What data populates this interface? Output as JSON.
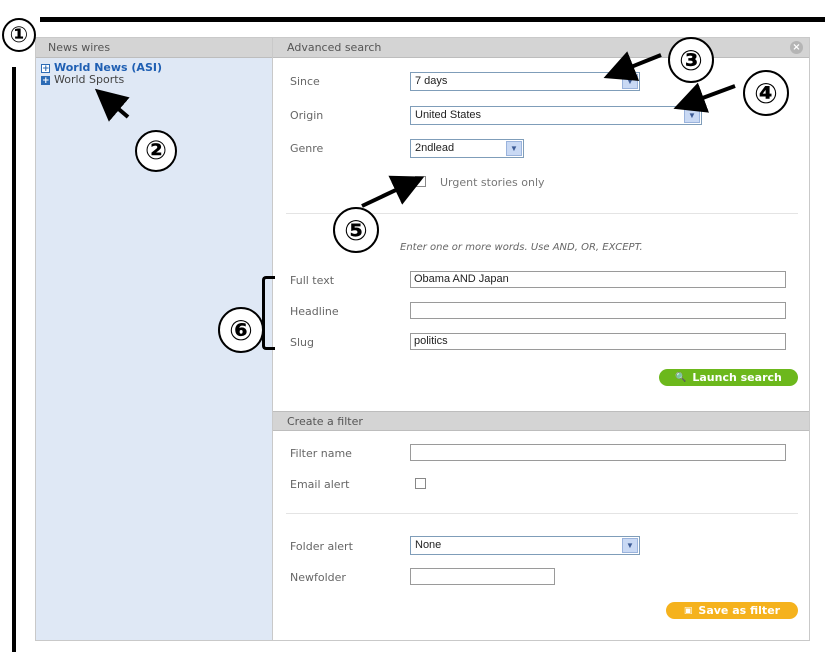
{
  "annotations": {
    "n1": "①",
    "n2": "②",
    "n3": "③",
    "n4": "④",
    "n5": "⑤",
    "n6": "⑥"
  },
  "left_panel": {
    "title": "News wires",
    "items": [
      {
        "label": "World News (ASI)",
        "active": true
      },
      {
        "label": "World Sports",
        "active": false
      }
    ]
  },
  "advanced_search": {
    "title": "Advanced search",
    "since_label": "Since",
    "since_value": "7 days",
    "origin_label": "Origin",
    "origin_value": "United States",
    "genre_label": "Genre",
    "genre_value": "2ndlead",
    "urgent_label": "Urgent stories only",
    "urgent_checked": true,
    "hint": "Enter one or more words. Use AND, OR, EXCEPT.",
    "fulltext_label": "Full text",
    "fulltext_value": "Obama AND Japan",
    "headline_label": "Headline",
    "headline_value": "",
    "slug_label": "Slug",
    "slug_value": "politics",
    "launch_label": "Launch search"
  },
  "filter": {
    "title": "Create a filter",
    "name_label": "Filter name",
    "name_value": "",
    "email_label": "Email alert",
    "email_checked": false,
    "folder_label": "Folder alert",
    "folder_value": "None",
    "newfolder_label": "Newfolder",
    "newfolder_value": "",
    "save_label": "Save as filter"
  },
  "colors": {
    "launch": "#6cb81c",
    "save": "#f5b21d",
    "link": "#1f5fb3"
  }
}
